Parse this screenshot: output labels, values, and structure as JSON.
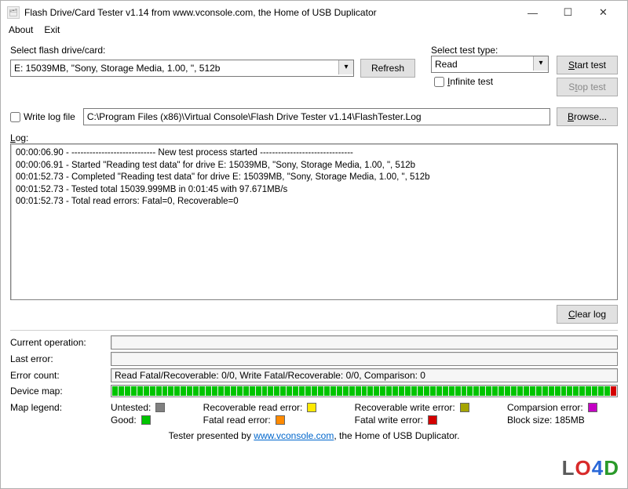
{
  "title": "Flash Drive/Card Tester v1.14 from www.vconsole.com, the Home of USB Duplicator",
  "menu": {
    "about": "About",
    "exit": "Exit"
  },
  "drive_section": {
    "label": "Select flash drive/card:",
    "selected": "E: 15039MB, \"Sony, Storage Media, 1.00, \", 512b",
    "refresh_btn": "Refresh"
  },
  "test_section": {
    "label": "Select test type:",
    "selected": "Read",
    "infinite_label": "Infinite test",
    "infinite_checked": false,
    "start_btn": "Start test",
    "stop_btn": "Stop test"
  },
  "logfile_section": {
    "checkbox_label": "Write log file",
    "checked": false,
    "path": "C:\\Program Files (x86)\\Virtual Console\\Flash Drive Tester v1.14\\FlashTester.Log",
    "browse_btn": "Browse..."
  },
  "log": {
    "label": "Log:",
    "lines": [
      "00:00:06.90 - ---------------------------- New test process started -------------------------------",
      "00:00:06.91 - Started \"Reading test data\" for drive E: 15039MB, \"Sony, Storage Media, 1.00, \", 512b",
      "00:01:52.73 - Completed \"Reading test data\" for drive E: 15039MB, \"Sony, Storage Media, 1.00, \", 512b",
      "00:01:52.73 - Tested total 15039.999MB in 0:01:45 with 97.671MB/s",
      "00:01:52.73 - Total read errors: Fatal=0, Recoverable=0"
    ],
    "clear_btn": "Clear log"
  },
  "status": {
    "current_op_label": "Current operation:",
    "current_op": "",
    "last_error_label": "Last error:",
    "last_error": "",
    "error_count_label": "Error count:",
    "error_count": "Read Fatal/Recoverable: 0/0, Write Fatal/Recoverable: 0/0, Comparison: 0",
    "device_map_label": "Device map:",
    "map_legend_label": "Map legend:"
  },
  "legend": {
    "untested": "Untested:",
    "good": "Good:",
    "rec_read": "Recoverable read error:",
    "fatal_read": "Fatal read error:",
    "rec_write": "Recoverable write error:",
    "fatal_write": "Fatal write error:",
    "comparison": "Comparsion error:",
    "block_size": "Block size: 185MB"
  },
  "colors": {
    "untested": "#808080",
    "good": "#00c400",
    "rec_read": "#ffe900",
    "fatal_read": "#ff8a00",
    "rec_write": "#a5a500",
    "fatal_write": "#d40000",
    "comparison": "#c400c4"
  },
  "device_map": {
    "good_blocks": 80,
    "tail_fatal": 1
  },
  "footer": {
    "prefix": "Tester presented by ",
    "link": "www.vconsole.com",
    "suffix": ", the Home of USB Duplicator."
  }
}
